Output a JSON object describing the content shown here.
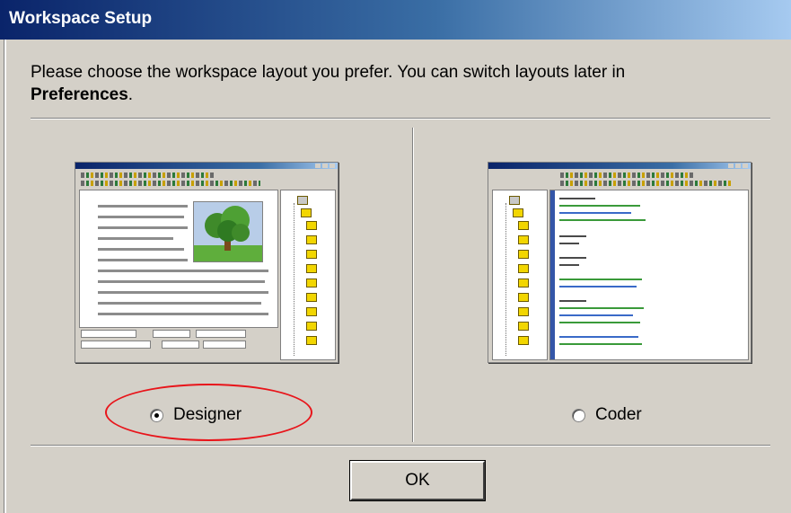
{
  "window": {
    "title": "Workspace Setup"
  },
  "instructions": {
    "text": "Please choose the workspace layout you prefer. You can switch layouts later in",
    "emphasis": "Preferences",
    "suffix": "."
  },
  "options": [
    {
      "id": "designer",
      "label": "Designer",
      "selected": true
    },
    {
      "id": "coder",
      "label": "Coder",
      "selected": false
    }
  ],
  "buttons": {
    "ok_label": "OK"
  },
  "colors": {
    "highlight": "#e8141a",
    "titlebar": "#0a246a",
    "dialog": "#d4d0c8"
  }
}
